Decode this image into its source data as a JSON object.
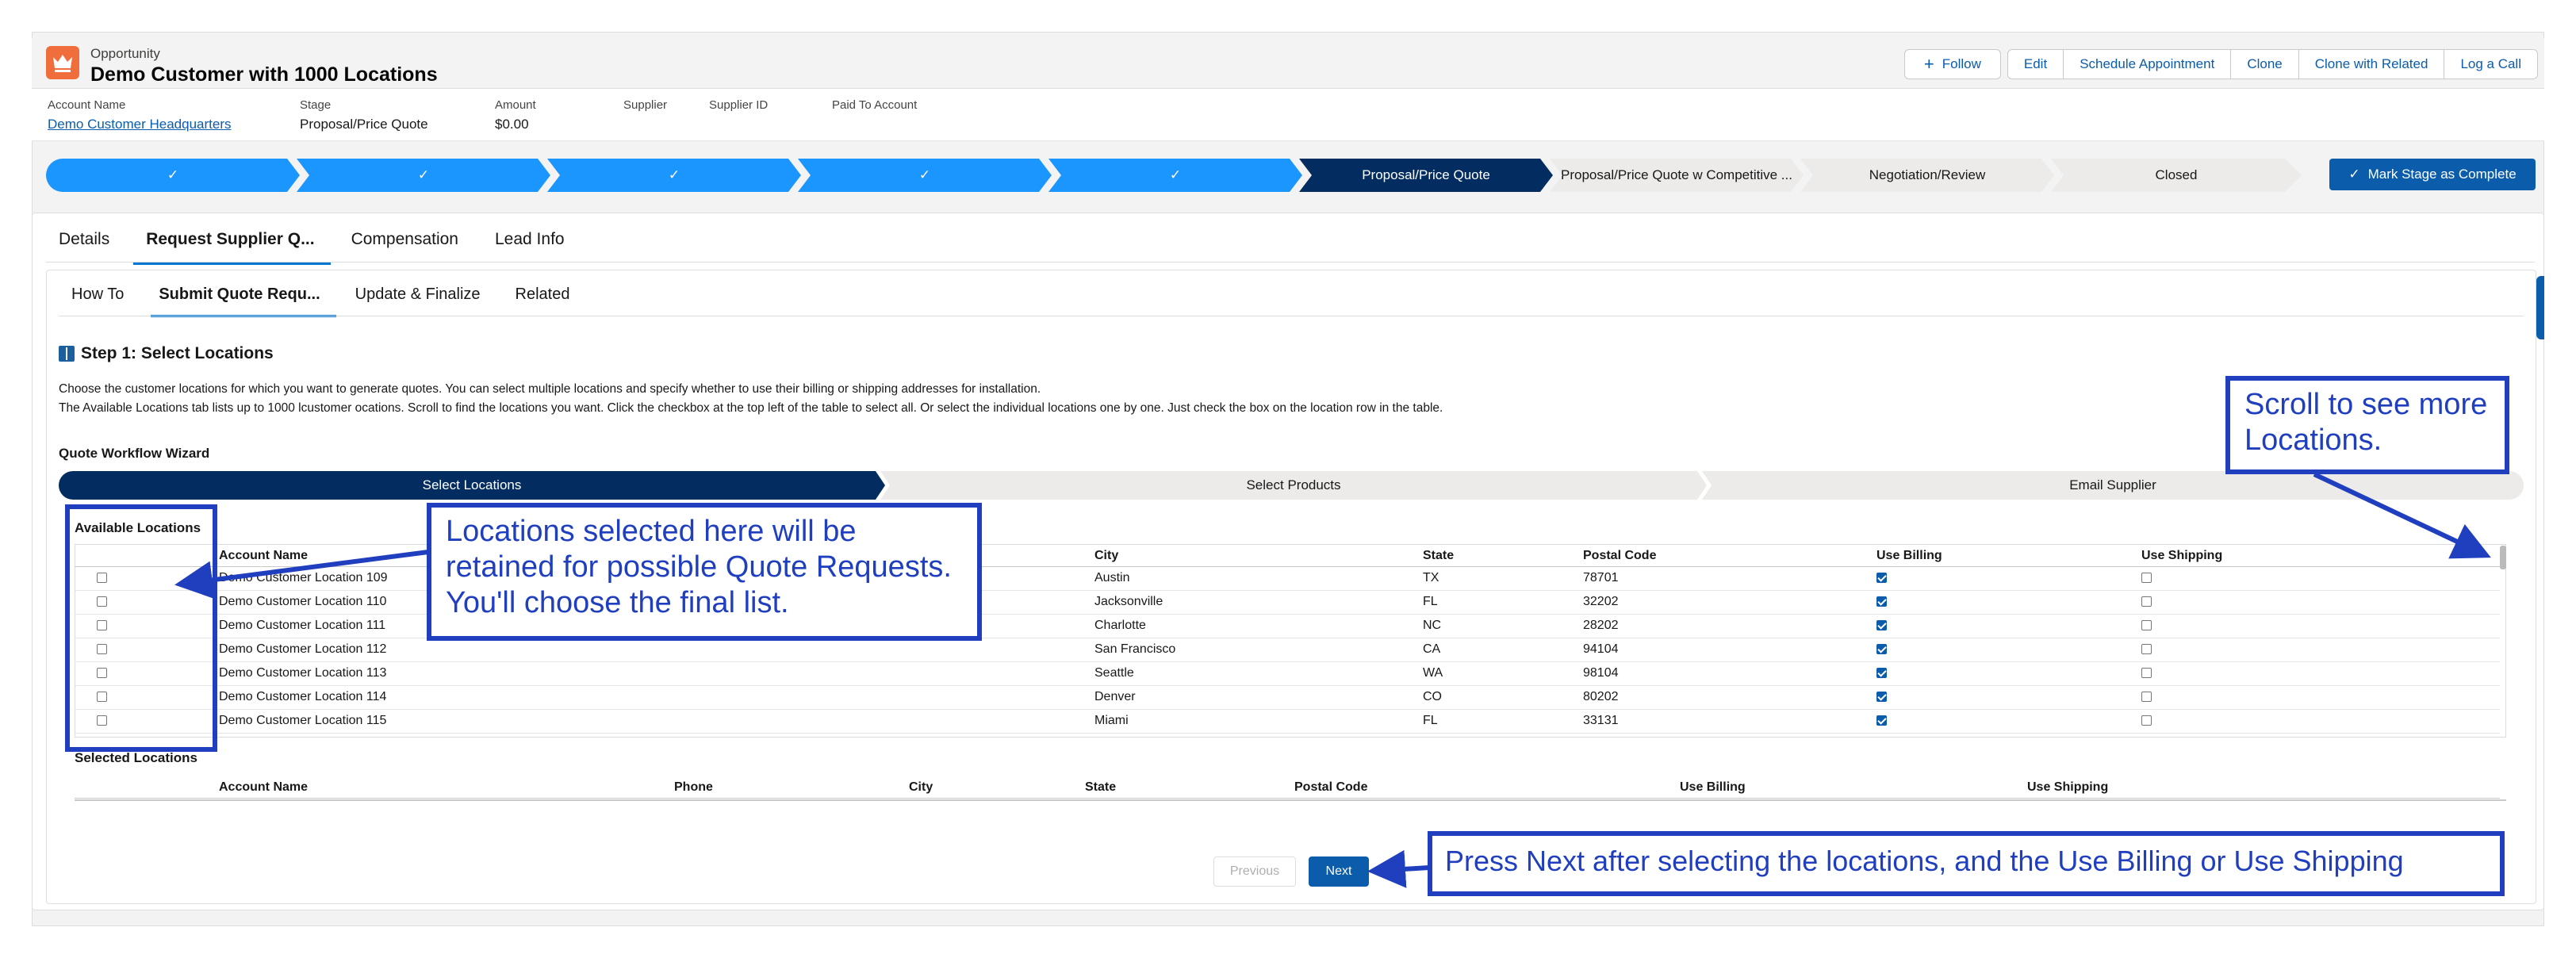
{
  "header": {
    "object_label": "Opportunity",
    "title": "Demo Customer with 1000 Locations",
    "buttons": {
      "follow": "Follow",
      "edit": "Edit",
      "schedule": "Schedule Appointment",
      "clone": "Clone",
      "clone_related": "Clone with Related",
      "log_call": "Log a Call"
    },
    "fields": [
      {
        "label": "Account Name",
        "value": "Demo Customer Headquarters"
      },
      {
        "label": "Stage",
        "value": "Proposal/Price Quote"
      },
      {
        "label": "Amount",
        "value": "$0.00"
      },
      {
        "label": "Supplier",
        "value": ""
      },
      {
        "label": "Supplier ID",
        "value": ""
      },
      {
        "label": "Paid To Account",
        "value": ""
      }
    ]
  },
  "path": {
    "steps": [
      {
        "label": "✓",
        "status": "done"
      },
      {
        "label": "✓",
        "status": "done"
      },
      {
        "label": "✓",
        "status": "done"
      },
      {
        "label": "✓",
        "status": "done"
      },
      {
        "label": "✓",
        "status": "done"
      },
      {
        "label": "Proposal/Price Quote",
        "status": "current"
      },
      {
        "label": "Proposal/Price Quote w Competitive ...",
        "status": "todo"
      },
      {
        "label": "Negotiation/Review",
        "status": "todo"
      },
      {
        "label": "Closed",
        "status": "todo"
      }
    ],
    "mark_complete": "Mark Stage as Complete"
  },
  "tabs": [
    "Details",
    "Request Supplier Q...",
    "Compensation",
    "Lead Info"
  ],
  "subtabs": [
    "How To",
    "Submit Quote Requ...",
    "Update & Finalize",
    "Related"
  ],
  "step": {
    "title": "Step 1: Select Locations",
    "desc1": "Choose the customer locations for which you want to generate quotes. You can select multiple locations and specify whether to use their billing or shipping addresses for installation.",
    "desc2": "The Available Locations tab lists up to 1000 lcustomer ocations. Scroll to find the locations you want. Click the checkbox at the top left of the table to select all. Or select the individual locations one by one. Just check the box on the location row in the table."
  },
  "wizard": {
    "title": "Quote Workflow Wizard",
    "steps": [
      "Select Locations",
      "Select Products",
      "Email Supplier"
    ]
  },
  "available": {
    "label": "Available Locations",
    "columns": [
      "Account Name",
      "Phone",
      "City",
      "State",
      "Postal Code",
      "Use Billing",
      "Use Shipping"
    ],
    "rows": [
      {
        "name": "Demo Customer Location 109",
        "phone": "",
        "city": "Austin",
        "state": "TX",
        "postal": "78701",
        "billing": true,
        "shipping": false
      },
      {
        "name": "Demo Customer Location 110",
        "phone": "",
        "city": "Jacksonville",
        "state": "FL",
        "postal": "32202",
        "billing": true,
        "shipping": false
      },
      {
        "name": "Demo Customer Location 111",
        "phone": "",
        "city": "Charlotte",
        "state": "NC",
        "postal": "28202",
        "billing": true,
        "shipping": false
      },
      {
        "name": "Demo Customer Location 112",
        "phone": "",
        "city": "San Francisco",
        "state": "CA",
        "postal": "94104",
        "billing": true,
        "shipping": false
      },
      {
        "name": "Demo Customer Location 113",
        "phone": "",
        "city": "Seattle",
        "state": "WA",
        "postal": "98104",
        "billing": true,
        "shipping": false
      },
      {
        "name": "Demo Customer Location 114",
        "phone": "",
        "city": "Denver",
        "state": "CO",
        "postal": "80202",
        "billing": true,
        "shipping": false
      },
      {
        "name": "Demo Customer Location 115",
        "phone": "",
        "city": "Miami",
        "state": "FL",
        "postal": "33131",
        "billing": true,
        "shipping": false
      }
    ]
  },
  "selected": {
    "label": "Selected Locations",
    "columns": [
      "Account Name",
      "Phone",
      "City",
      "State",
      "Postal Code",
      "Use Billing",
      "Use Shipping"
    ]
  },
  "nav": {
    "previous": "Previous",
    "next": "Next"
  },
  "annotations": {
    "locations": "Locations selected here will be retained for possible Quote Requests. You'll choose the final list.",
    "scroll": "Scroll to see more Locations.",
    "next": "Press Next after selecting the locations, and the Use Billing or Use Shipping"
  },
  "colors": {
    "brand": "#0b5cab",
    "path_done": "#1b96ff",
    "path_current": "#032d60",
    "annotation": "#1f3fbf",
    "opportunity_icon": "#ef6e3b"
  }
}
